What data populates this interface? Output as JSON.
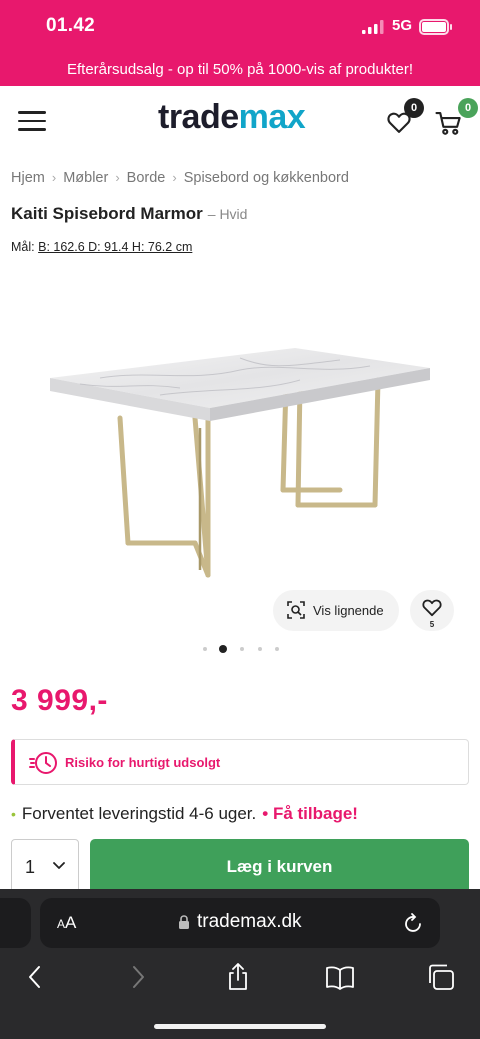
{
  "status_bar": {
    "time": "01.42",
    "network": "5G"
  },
  "promo_banner": {
    "text": "Efterårsudsalg - op til 50% på 1000-vis af produkter!"
  },
  "header": {
    "logo_part1": "trade",
    "logo_part2": "max",
    "wishlist_count": "0",
    "cart_count": "0"
  },
  "breadcrumb": [
    "Hjem",
    "Møbler",
    "Borde",
    "Spisebord og køkkenbord"
  ],
  "product": {
    "title": "Kaiti Spisebord Marmor",
    "variant": "– Hvid",
    "dims_label": "Mål:",
    "dims_value": "B: 162.6 D: 91.4 H: 76.2 cm",
    "price": "3 999,-",
    "favorites_count": "5"
  },
  "actions": {
    "similar_label": "Vis lignende",
    "alert_text": "Risiko for hurtigt udsolgt",
    "delivery_text": "Forventet leveringstid 4-6 uger.",
    "return_text": "• Få tilbage!",
    "quantity": "1",
    "add_to_cart": "Læg i kurven"
  },
  "carousel": {
    "total": 5,
    "active": 2
  },
  "browser": {
    "aa_small": "A",
    "aa_big": "A",
    "url": "trademax.dk"
  },
  "colors": {
    "brand_pink": "#e8186d",
    "cart_green": "#3fa05a",
    "logo_blue": "#11a5c9"
  }
}
